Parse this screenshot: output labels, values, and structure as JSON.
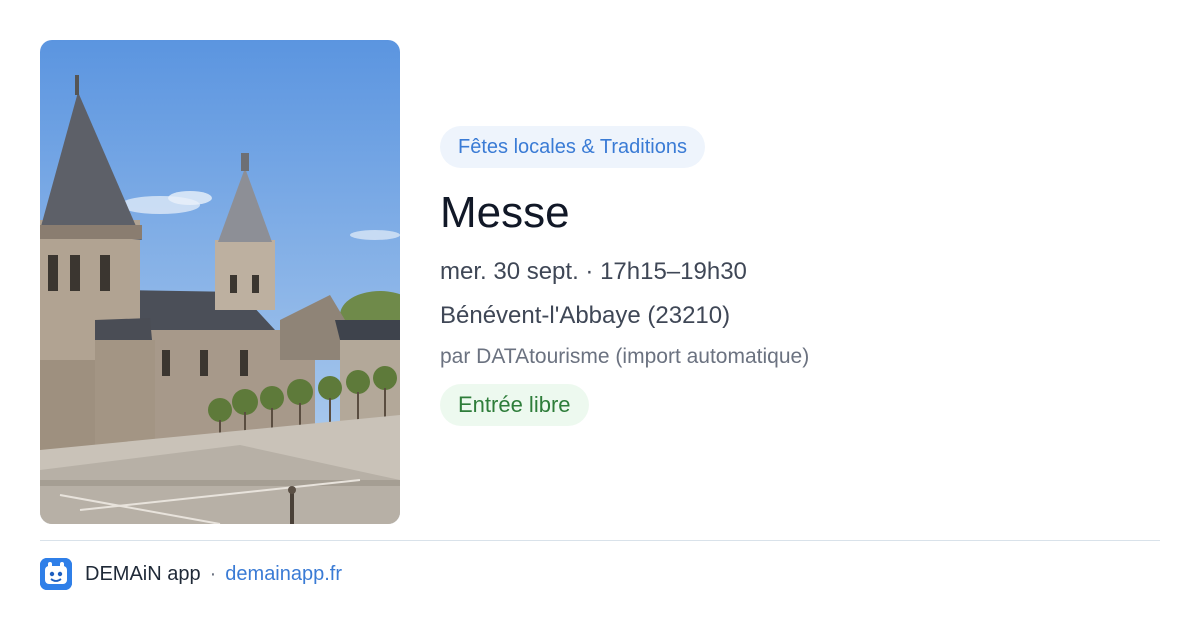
{
  "event": {
    "category": "Fêtes locales & Traditions",
    "title": "Messe",
    "date_time": "mer. 30 sept. · 17h15–19h30",
    "location": "Bénévent-l'Abbaye (23210)",
    "source": "par DATAtourisme (import automatique)",
    "price": "Entrée libre",
    "image": "church-photo"
  },
  "footer": {
    "logo_icon": "demain-logo-icon",
    "brand": "DEMAiN app",
    "separator": "·",
    "link": "demainapp.fr"
  },
  "colors": {
    "accent": "#3a7bd5",
    "category_bg": "#eef4fc",
    "price_text": "#2e7d3a",
    "price_bg": "#edf9ef",
    "divider": "#d9e2ea"
  }
}
